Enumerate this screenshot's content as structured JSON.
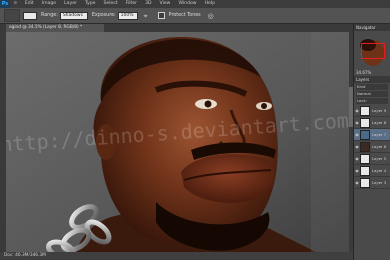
{
  "app": {
    "logo_text": "Ps"
  },
  "menu": {
    "items": [
      "e",
      "Edit",
      "Image",
      "Layer",
      "Type",
      "Select",
      "Filter",
      "3D",
      "View",
      "Window",
      "Help"
    ]
  },
  "options_bar": {
    "range_label": "Range:",
    "range_value": "Shadows",
    "exposure_label": "Exposure:",
    "exposure_value": "100%",
    "protect_tones_label": "Protect Tones"
  },
  "document": {
    "tab_title": "ogind @ 34.5% (Layer 8, RGB/8) *",
    "watermark": "http://dinno-s.deviantart.com"
  },
  "status_bar": {
    "text": "Doc: 46.3M/346.3M"
  },
  "panels": {
    "navigator_tab": "Navigator",
    "zoom": "34.67%",
    "layers_tab": "Layers",
    "kind_label": "Kind",
    "blend_mode": "Normal",
    "lock_label": "Lock:",
    "layers": [
      {
        "name": "Layer 9",
        "selected": false
      },
      {
        "name": "Layer 8",
        "selected": false
      },
      {
        "name": "Layer 7",
        "selected": true
      },
      {
        "name": "Layer 6",
        "selected": false
      },
      {
        "name": "Layer 5",
        "selected": false
      },
      {
        "name": "Layer 4",
        "selected": false
      },
      {
        "name": "Layer 3",
        "selected": false
      }
    ]
  }
}
